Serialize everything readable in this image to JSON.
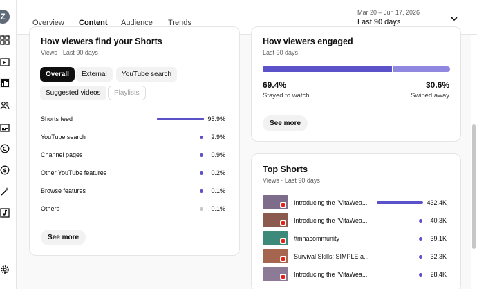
{
  "rail": {
    "avatar_letter": "Z",
    "icons": [
      "dashboard-icon",
      "content-icon",
      "analytics-icon",
      "community-icon",
      "subtitles-icon",
      "copyright-icon",
      "earn-icon",
      "customization-icon",
      "audio-library-icon",
      "settings-icon"
    ]
  },
  "header": {
    "tabs": [
      {
        "label": "Overview",
        "active": false
      },
      {
        "label": "Content",
        "active": true
      },
      {
        "label": "Audience",
        "active": false
      },
      {
        "label": "Trends",
        "active": false
      }
    ],
    "date_range": "Mar 20 – Jun 17, 2026",
    "period_label": "Last 90 days"
  },
  "find_card": {
    "title": "How viewers find your Shorts",
    "subtitle": "Views · Last 90 days",
    "chips": [
      {
        "label": "Overall",
        "state": "selected"
      },
      {
        "label": "External",
        "state": "normal"
      },
      {
        "label": "YouTube search",
        "state": "normal"
      },
      {
        "label": "Suggested videos",
        "state": "normal"
      },
      {
        "label": "Playlists",
        "state": "disabled"
      }
    ],
    "sources": [
      {
        "label": "Shorts feed",
        "value": "95.9%",
        "share": 0.959
      },
      {
        "label": "YouTube search",
        "value": "2.9%",
        "share": 0.029
      },
      {
        "label": "Channel pages",
        "value": "0.9%",
        "share": 0.009
      },
      {
        "label": "Other YouTube features",
        "value": "0.2%",
        "share": 0.002
      },
      {
        "label": "Browse features",
        "value": "0.1%",
        "share": 0.001
      },
      {
        "label": "Others",
        "value": "0.1%",
        "share": 0.001
      }
    ],
    "see_more": "See more"
  },
  "engaged_card": {
    "title": "How viewers engaged",
    "subtitle": "Last 90 days",
    "stayed_pct": "69.4%",
    "stayed_label": "Stayed to watch",
    "swiped_pct": "30.6%",
    "swiped_label": "Swiped away",
    "stayed_share": 0.694,
    "see_more": "See more"
  },
  "top_shorts": {
    "title": "Top Shorts",
    "subtitle": "Views · Last 90 days",
    "items": [
      {
        "title": "Introducing the \"VitaWea...",
        "views": "432.4K",
        "thumb_color": "#7d6d8a"
      },
      {
        "title": "Introducing the \"VitaWea...",
        "views": "40.3K",
        "thumb_color": "#8a5b4e"
      },
      {
        "title": "#mhacommunity",
        "views": "39.1K",
        "thumb_color": "#3d8a7a"
      },
      {
        "title": "Survival Skills: SIMPLE a...",
        "views": "32.3K",
        "thumb_color": "#a5654f"
      },
      {
        "title": "Introducing the \"VitaWea...",
        "views": "28.4K",
        "thumb_color": "#8c7a96"
      }
    ]
  },
  "colors": {
    "accent": "#5b51c9",
    "accent_light": "#8f87e0"
  }
}
